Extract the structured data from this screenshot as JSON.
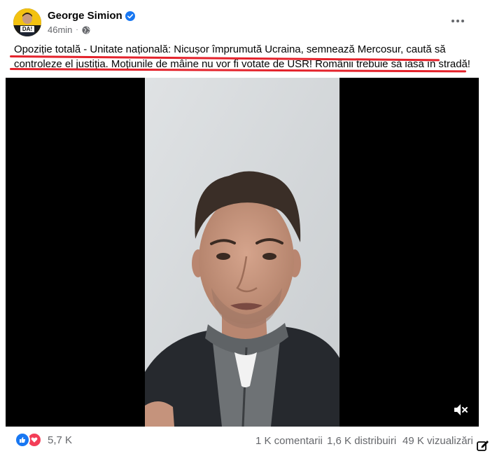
{
  "post": {
    "author": "George Simion",
    "time": "46min",
    "separator": "·",
    "avatar_badge": "DA!",
    "text_line1": "Opoziție totală - Unitate națională: Nicușor împrumută Ucraina, semnează Mercosur, caută să",
    "text_line2": "controleze el justiția. Moțiunile de mâine nu vor fi votate de USR! Românii trebuie să iasă în stradă!",
    "icons": {
      "verified": "verified-badge-icon",
      "audience": "globe-icon",
      "more": "more-options-icon",
      "mute": "speaker-muted-icon",
      "edit": "edit-icon"
    },
    "colors": {
      "accent_blue": "#1877f2",
      "love_red": "#f33e58",
      "underline_red": "#e4222b",
      "meta_gray": "#65676b"
    }
  },
  "footer": {
    "reaction_count": "5,7 K",
    "comments": "1 K comentarii",
    "shares": "1,6 K distribuiri",
    "views": "49 K vizualizări"
  }
}
